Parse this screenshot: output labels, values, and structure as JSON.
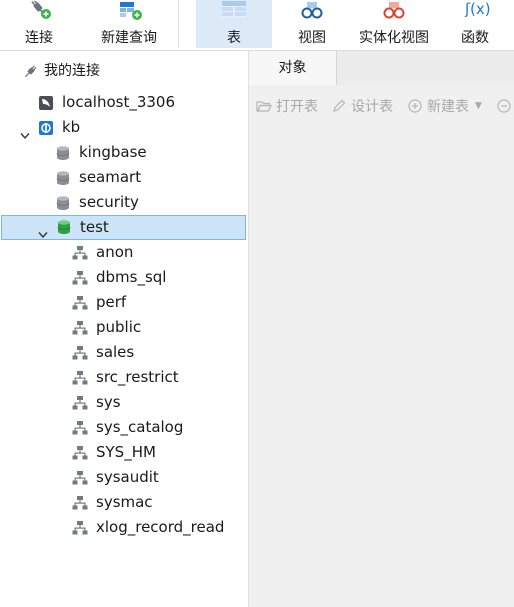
{
  "toolbar": {
    "connect": "连接",
    "new_query": "新建查询",
    "table": "表",
    "view": "视图",
    "materialized_view": "实体化视图",
    "function": "函数",
    "function_icon_text": "ʃ(x)"
  },
  "sidebar": {
    "header": "我的连接",
    "tree": [
      {
        "label": "localhost_3306",
        "icon": "mysql-connection-icon"
      },
      {
        "label": "kb",
        "icon": "kingbase-connection-icon",
        "expanded": true
      },
      {
        "label": "kingbase",
        "icon": "database-icon"
      },
      {
        "label": "seamart",
        "icon": "database-icon"
      },
      {
        "label": "security",
        "icon": "database-icon"
      },
      {
        "label": "test",
        "icon": "database-open-icon",
        "expanded": true,
        "selected": true
      },
      {
        "label": "anon",
        "icon": "schema-icon"
      },
      {
        "label": "dbms_sql",
        "icon": "schema-icon"
      },
      {
        "label": "perf",
        "icon": "schema-icon"
      },
      {
        "label": "public",
        "icon": "schema-icon"
      },
      {
        "label": "sales",
        "icon": "schema-icon"
      },
      {
        "label": "src_restrict",
        "icon": "schema-icon"
      },
      {
        "label": "sys",
        "icon": "schema-icon"
      },
      {
        "label": "sys_catalog",
        "icon": "schema-icon"
      },
      {
        "label": "SYS_HM",
        "icon": "schema-icon"
      },
      {
        "label": "sysaudit",
        "icon": "schema-icon"
      },
      {
        "label": "sysmac",
        "icon": "schema-icon"
      },
      {
        "label": "xlog_record_read",
        "icon": "schema-icon"
      }
    ]
  },
  "main": {
    "tab_objects": "对象",
    "open_table": "打开表",
    "design_table": "设计表",
    "new_table": "新建表"
  },
  "colors": {
    "accent": "#1e78d7",
    "selection_bg": "#cce4f7",
    "selection_border": "#7fb4e3",
    "active_tool_bg": "#dce9f7",
    "db_green": "#3bb54a",
    "disabled_text": "#a8a8a8"
  }
}
